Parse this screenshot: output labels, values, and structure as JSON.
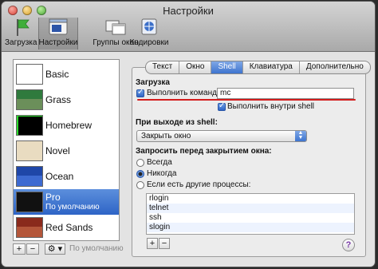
{
  "window": {
    "title": "Настройки"
  },
  "toolbar": {
    "items": [
      {
        "label": "Загрузка"
      },
      {
        "label": "Настройки"
      },
      {
        "label": "Группы окон"
      },
      {
        "label": "Кодировки"
      }
    ]
  },
  "sidebar": {
    "profiles": [
      {
        "name": "Basic"
      },
      {
        "name": "Grass"
      },
      {
        "name": "Homebrew"
      },
      {
        "name": "Novel"
      },
      {
        "name": "Ocean"
      },
      {
        "name": "Pro",
        "subtitle": "По умолчанию"
      },
      {
        "name": "Red Sands"
      }
    ],
    "add_label": "+",
    "remove_label": "−",
    "gear_label": "⚙ ▾",
    "default_label": "По умолчанию"
  },
  "tabs": [
    {
      "label": "Текст"
    },
    {
      "label": "Окно"
    },
    {
      "label": "Shell"
    },
    {
      "label": "Клавиатура"
    },
    {
      "label": "Дополнительно"
    }
  ],
  "shell": {
    "startup_heading": "Загрузка",
    "run_command_label": "Выполнить команду:",
    "command_value": "mc",
    "run_inside_shell_label": "Выполнить внутри shell",
    "on_exit_heading": "При выходе из shell:",
    "on_exit_value": "Закрыть окно",
    "ask_before_close_heading": "Запросить перед закрытием окна:",
    "radio_always": "Всегда",
    "radio_never": "Никогда",
    "radio_if_other": "Если есть другие процессы:",
    "processes": [
      "rlogin",
      "telnet",
      "ssh",
      "slogin"
    ],
    "add_label": "+",
    "remove_label": "−",
    "help_label": "?"
  },
  "colors": {
    "selection": "#3e74cf",
    "underline": "#d41d1d"
  }
}
